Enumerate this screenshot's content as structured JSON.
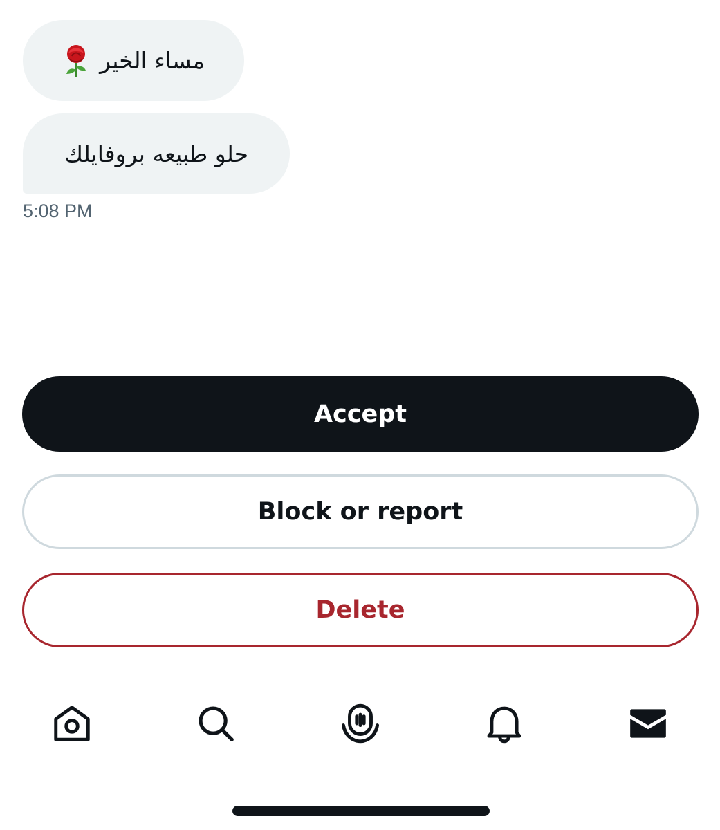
{
  "messages": [
    {
      "text": "مساء الخير",
      "emoji": "rose-icon"
    },
    {
      "text": "حلو طبيعه بروفايلك"
    }
  ],
  "timestamp": "5:08 PM",
  "actions": {
    "accept_label": "Accept",
    "block_label": "Block or report",
    "delete_label": "Delete"
  },
  "tabbar": {
    "icons": [
      "home-icon",
      "search-icon",
      "spaces-icon",
      "notifications-icon",
      "messages-icon"
    ]
  },
  "colors": {
    "text_primary": "#0f1419",
    "text_secondary": "#536471",
    "bubble_bg": "#eff3f4",
    "danger": "#a8262e",
    "border": "#cfd9de"
  }
}
